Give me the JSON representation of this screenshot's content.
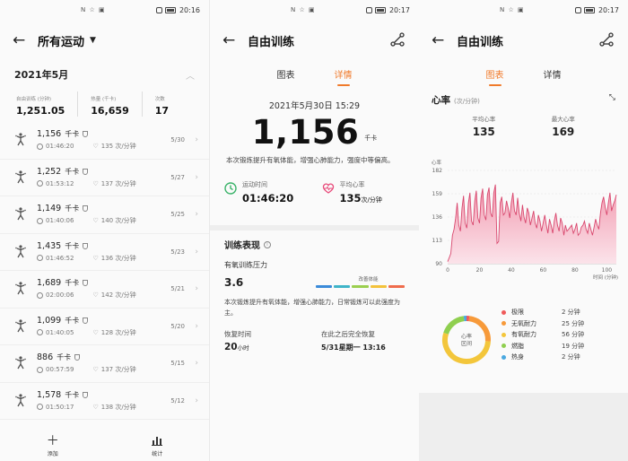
{
  "status": {
    "carrier": "N ☆ ▣",
    "time1": "20:16",
    "time2": "20:17",
    "time3": "20:17"
  },
  "screen1": {
    "title": "所有运动",
    "month": "2021年5月",
    "summary": [
      {
        "label": "自由训练 (分钟)",
        "value": "1,251.05"
      },
      {
        "label": "热量 (千卡)",
        "value": "16,659"
      },
      {
        "label": "次数",
        "value": "17"
      }
    ],
    "records": [
      {
        "kcal": "1,156",
        "unit": "千卡",
        "duration": "01:46:20",
        "hr": "135 次/分钟",
        "date": "5/30"
      },
      {
        "kcal": "1,252",
        "unit": "千卡",
        "duration": "01:53:12",
        "hr": "137 次/分钟",
        "date": "5/27"
      },
      {
        "kcal": "1,149",
        "unit": "千卡",
        "duration": "01:40:06",
        "hr": "140 次/分钟",
        "date": "5/25"
      },
      {
        "kcal": "1,435",
        "unit": "千卡",
        "duration": "01:46:52",
        "hr": "136 次/分钟",
        "date": "5/23"
      },
      {
        "kcal": "1,689",
        "unit": "千卡",
        "duration": "02:00:06",
        "hr": "142 次/分钟",
        "date": "5/21"
      },
      {
        "kcal": "1,099",
        "unit": "千卡",
        "duration": "01:40:05",
        "hr": "128 次/分钟",
        "date": "5/20"
      },
      {
        "kcal": "886",
        "unit": "千卡",
        "duration": "00:57:59",
        "hr": "137 次/分钟",
        "date": "5/15"
      },
      {
        "kcal": "1,578",
        "unit": "千卡",
        "duration": "01:50:17",
        "hr": "138 次/分钟",
        "date": "5/12"
      }
    ],
    "nav": {
      "add": "添加",
      "stats": "统计"
    }
  },
  "screen2": {
    "title": "自由训练",
    "tabs": [
      "图表",
      "详情"
    ],
    "datetime": "2021年5月30日 15:29",
    "calories": "1,156",
    "calories_unit": "千卡",
    "desc": "本次锻炼提升有氧体能，增强心肺能力，强度中等偏高。",
    "duration_label": "运动时间",
    "duration_value": "01:46:20",
    "avg_hr_label": "平均心率",
    "avg_hr_value": "135",
    "avg_hr_unit": "次/分钟",
    "perf_title": "训练表现",
    "aerobic_label": "有氧训练压力",
    "aerobic_value": "3.6",
    "aerobic_level": "改善体能",
    "aerobic_desc": "本次锻炼提升有氧体能，增强心肺能力，日常锻炼可以此强度为主。",
    "recovery_label": "恢复时间",
    "recovery_value": "20",
    "recovery_unit": "小时",
    "full_recovery_label": "在此之后完全恢复",
    "full_recovery_value": "5/31星期一 13:16",
    "bar_colors": [
      "#3b8bd9",
      "#3fb4c8",
      "#9bcf4f",
      "#f3c23b",
      "#ef6c4c"
    ]
  },
  "screen3": {
    "title": "自由训练",
    "tabs": [
      "图表",
      "详情"
    ],
    "hr_title": "心率",
    "hr_unit": "(次/分钟)",
    "avg_label": "平均心率",
    "avg_value": "135",
    "max_label": "最大心率",
    "max_value": "169",
    "donut_label_1": "心率",
    "donut_label_2": "区间",
    "zones": [
      {
        "name": "极限",
        "duration": "2 分钟",
        "color": "#ef5a5a"
      },
      {
        "name": "无氧耐力",
        "duration": "25 分钟",
        "color": "#f79a3a"
      },
      {
        "name": "有氧耐力",
        "duration": "56 分钟",
        "color": "#f3c63b"
      },
      {
        "name": "燃脂",
        "duration": "19 分钟",
        "color": "#8fcf4f"
      },
      {
        "name": "热身",
        "duration": "2 分钟",
        "color": "#4aa8e0"
      }
    ]
  },
  "chart_data": {
    "type": "area",
    "title": "心率",
    "ylabel": "心率",
    "xlabel": "时间 (分钟)",
    "yticks": [
      90,
      113,
      136,
      159,
      182
    ],
    "xticks": [
      0,
      20,
      40,
      60,
      80,
      100
    ],
    "ylim": [
      90,
      182
    ],
    "xlim": [
      0,
      106
    ],
    "grid": true,
    "series": [
      {
        "name": "心率",
        "x": [
          0,
          1,
          2,
          3,
          4,
          5,
          6,
          7,
          8,
          9,
          10,
          11,
          12,
          13,
          14,
          15,
          16,
          17,
          18,
          19,
          20,
          21,
          22,
          23,
          24,
          25,
          26,
          27,
          28,
          29,
          30,
          31,
          32,
          33,
          34,
          35,
          36,
          37,
          38,
          39,
          40,
          41,
          42,
          43,
          44,
          45,
          46,
          47,
          48,
          49,
          50,
          51,
          52,
          53,
          54,
          55,
          56,
          57,
          58,
          59,
          60,
          61,
          62,
          63,
          64,
          65,
          66,
          67,
          68,
          69,
          70,
          71,
          72,
          73,
          74,
          75,
          76,
          77,
          78,
          79,
          80,
          81,
          82,
          83,
          84,
          85,
          86,
          87,
          88,
          89,
          90,
          91,
          92,
          93,
          94,
          95,
          96,
          97,
          98,
          99,
          100,
          101,
          102,
          103,
          104,
          105,
          106
        ],
        "values": [
          92,
          96,
          100,
          118,
          124,
          135,
          150,
          128,
          122,
          145,
          157,
          130,
          125,
          150,
          160,
          132,
          128,
          152,
          162,
          135,
          130,
          155,
          164,
          138,
          133,
          158,
          165,
          140,
          136,
          160,
          168,
          110,
          112,
          150,
          156,
          138,
          140,
          152,
          145,
          135,
          150,
          160,
          142,
          138,
          155,
          140,
          132,
          148,
          136,
          130,
          145,
          140,
          128,
          135,
          142,
          130,
          125,
          138,
          132,
          122,
          130,
          138,
          128,
          120,
          134,
          128,
          120,
          132,
          140,
          128,
          122,
          135,
          130,
          118,
          128,
          122,
          124,
          126,
          128,
          120,
          124,
          130,
          118,
          120,
          126,
          128,
          132,
          124,
          120,
          130,
          124,
          118,
          126,
          134,
          128,
          124,
          140,
          150,
          156,
          146,
          138,
          150,
          160,
          142,
          148,
          152,
          158
        ]
      }
    ]
  }
}
